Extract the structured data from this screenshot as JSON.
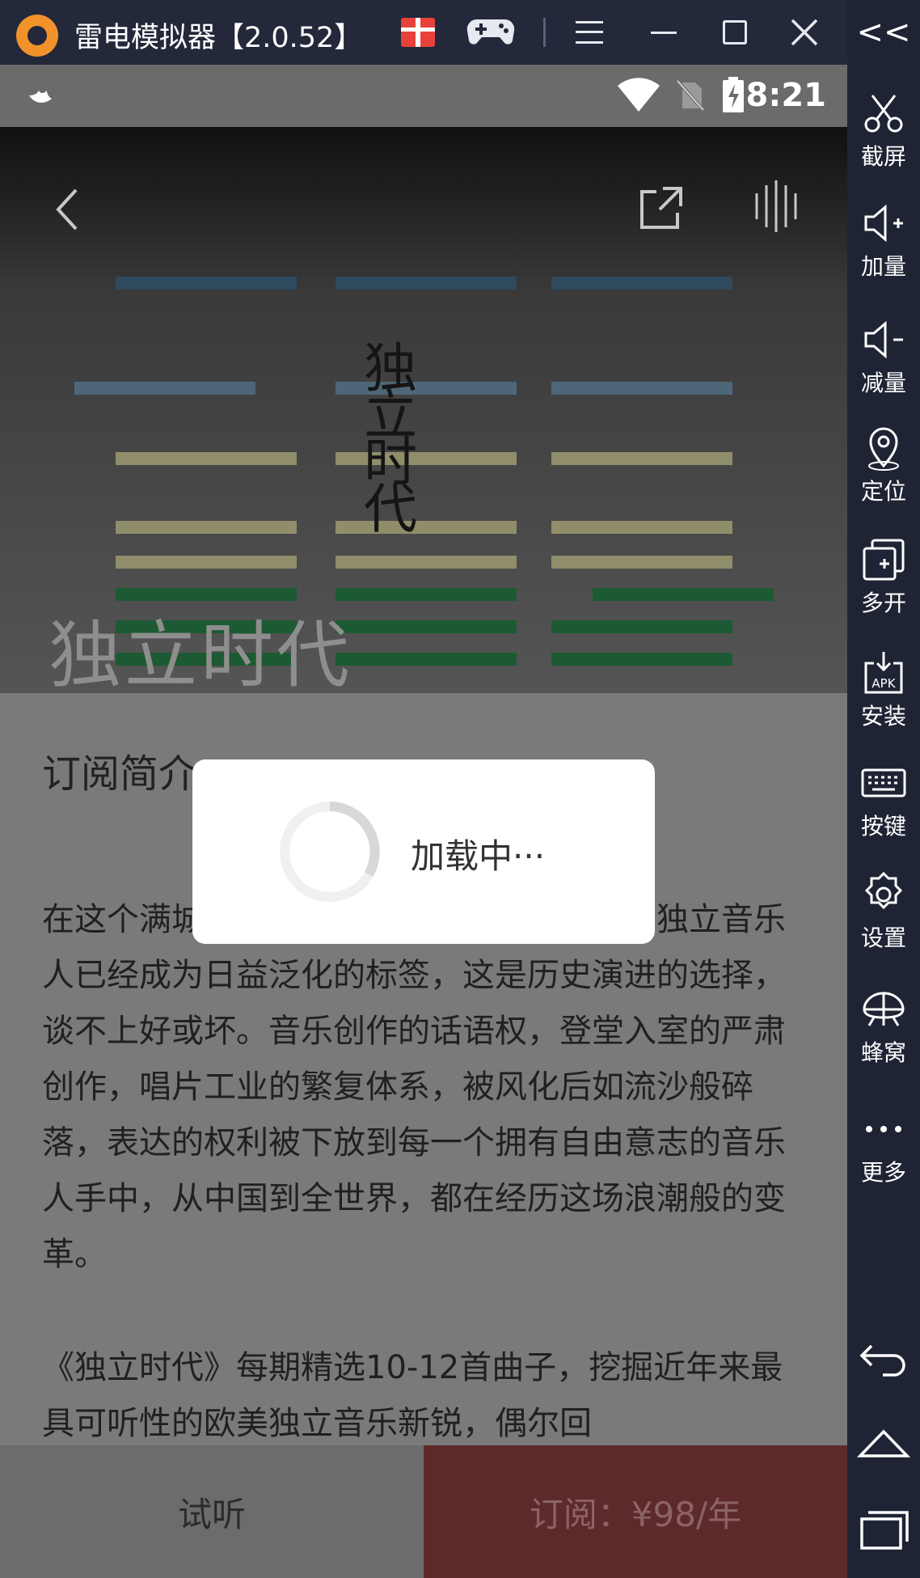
{
  "window": {
    "title": "雷电模拟器【2.0.52】",
    "icons": [
      "leidian-logo-icon",
      "gift-icon",
      "gamepad-icon",
      "menu-icon",
      "minimize-icon",
      "maximize-icon",
      "close-icon"
    ]
  },
  "toolbar": {
    "collapse_label": "<<",
    "items": [
      {
        "icon": "scissors-icon",
        "label": "截屏"
      },
      {
        "icon": "volume-up-icon",
        "label": "加量"
      },
      {
        "icon": "volume-down-icon",
        "label": "减量"
      },
      {
        "icon": "location-icon",
        "label": "定位"
      },
      {
        "icon": "multi-open-icon",
        "label": "多开"
      },
      {
        "icon": "apk-install-icon",
        "label": "安装"
      },
      {
        "icon": "keyboard-icon",
        "label": "按键"
      },
      {
        "icon": "settings-icon",
        "label": "设置"
      },
      {
        "icon": "hive-icon",
        "label": "蜂窝"
      },
      {
        "icon": "more-icon",
        "label": "更多"
      }
    ],
    "nav": [
      "back-nav-icon",
      "home-nav-icon",
      "recents-nav-icon"
    ]
  },
  "statusbar": {
    "time": "8:21",
    "icons": [
      "app-notification-icon",
      "wifi-icon",
      "no-sim-icon",
      "battery-charging-icon"
    ]
  },
  "header": {
    "cover_title": "独立时代",
    "calligraphy_main": "独\n立\n时\n代",
    "icons": [
      "back-icon",
      "share-icon",
      "equalizer-icon"
    ]
  },
  "content": {
    "section_title": "订阅简介",
    "paragraph1": "在这个满城尽是手机传的时代，独立音乐和独立音乐人已经成为日益泛化的标签，这是历史演进的选择，谈不上好或坏。音乐创作的话语权，登堂入室的严肃创作，唱片工业的繁复体系，被风化后如流沙般碎落，表达的权利被下放到每一个拥有自由意志的音乐人手中，从中国到全世界，都在经历这场浪潮般的变革。",
    "paragraph2": "《独立时代》每期精选10-12首曲子，挖掘近年来最具可听性的欧美独立音乐新锐，偶尔回"
  },
  "bottombar": {
    "trial_label": "试听",
    "subscribe_label": "订阅：¥98/年"
  },
  "dialog": {
    "loading_text": "加载中···"
  },
  "colors": {
    "emulator_bg": "#23283a",
    "accent_orange": "#f2922a",
    "gift_red": "#e8413b",
    "subscribe_bg": "#5d2a2b",
    "hex_blue": "#2e4a5c",
    "hex_yellow": "#8f8d6a",
    "hex_green": "#1c5a33"
  }
}
